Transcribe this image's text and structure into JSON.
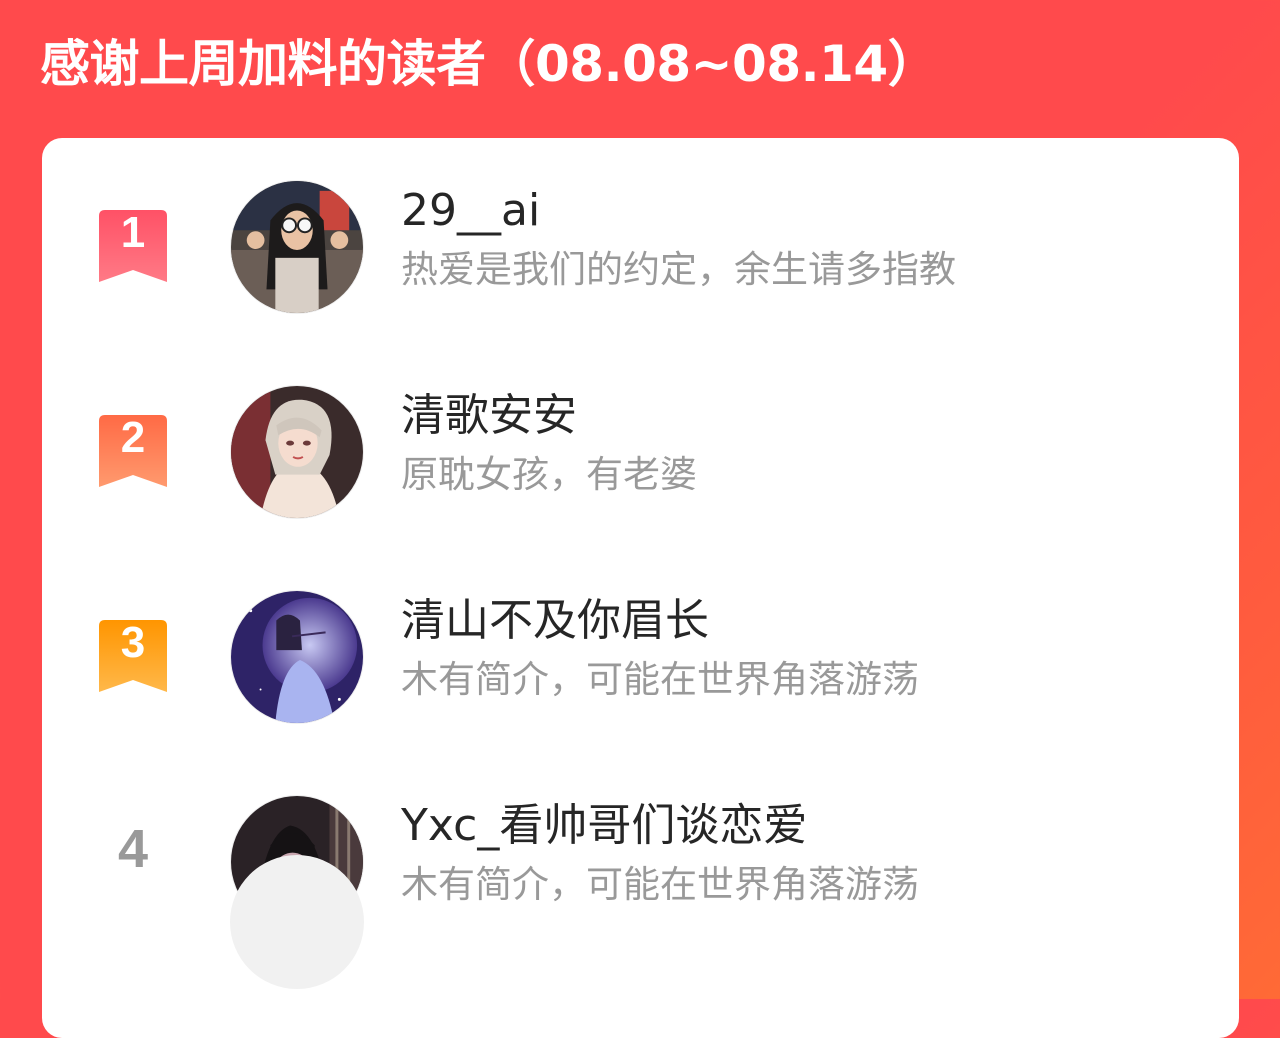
{
  "header": {
    "title": "感谢上周加料的读者（08.08~08.14）"
  },
  "colors": {
    "background": "#ff4a4c",
    "card": "#ffffff",
    "rank1": "#ff5b6b",
    "rank2": "#ff7a52",
    "rank3": "#ff9f1a",
    "name_text": "#262626",
    "bio_text": "#999999"
  },
  "readers": [
    {
      "rank": "1",
      "name": "29__ai",
      "bio": "热爱是我们的约定，余生请多指教"
    },
    {
      "rank": "2",
      "name": "清歌安安",
      "bio": "原耽女孩，有老婆"
    },
    {
      "rank": "3",
      "name": "清山不及你眉长",
      "bio": "木有简介，可能在世界角落游荡"
    },
    {
      "rank": "4",
      "name": "Yxc_看帅哥们谈恋爱",
      "bio": "木有简介，可能在世界角落游荡"
    }
  ]
}
